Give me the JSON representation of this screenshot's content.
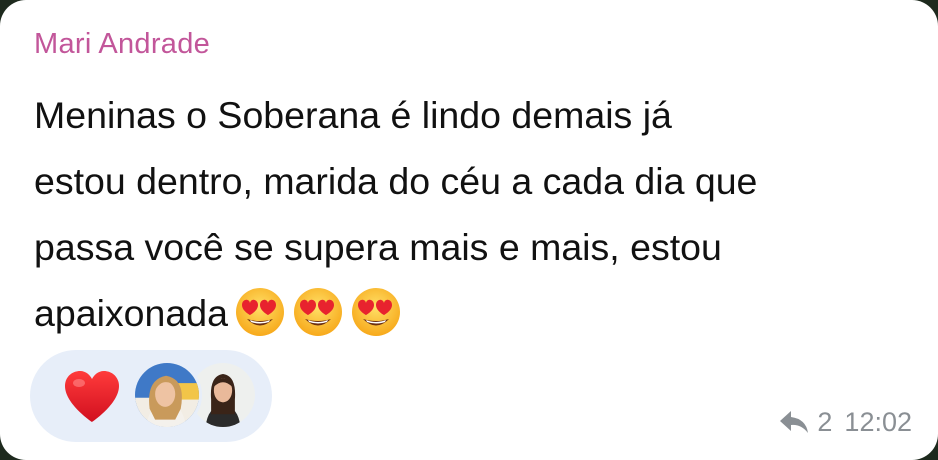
{
  "message": {
    "sender": "Mari Andrade",
    "lines": [
      "Meninas o Soberana é lindo demais já",
      "estou dentro, marida do céu a cada dia que",
      "passa você se supera mais e mais, estou",
      "apaixonada"
    ],
    "emojis": [
      "heart-eyes-emoji",
      "heart-eyes-emoji",
      "heart-eyes-emoji"
    ]
  },
  "reactions": {
    "emoji": "heart-icon",
    "avatars": [
      "avatar-blonde-woman",
      "avatar-brunette-woman"
    ]
  },
  "meta": {
    "reply_count": "2",
    "time": "12:02"
  },
  "colors": {
    "sender": "#c2569a",
    "bubble": "#ffffff",
    "reaction_pill": "#e7eef9",
    "meta_text": "#8a8f94"
  }
}
